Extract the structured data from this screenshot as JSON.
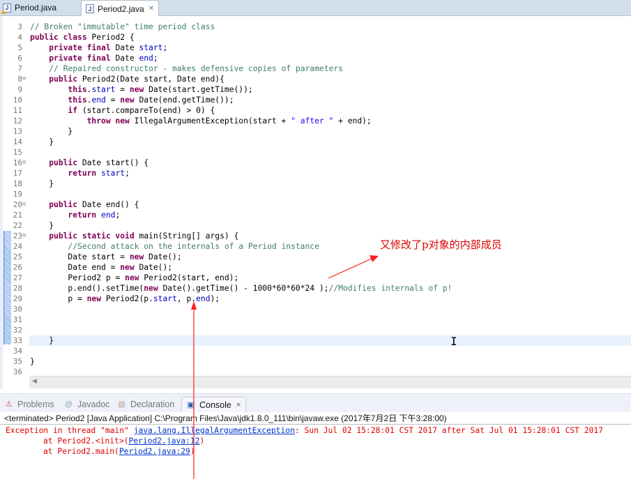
{
  "editor_tabs": [
    {
      "label": "Period.java",
      "icon": "java-file-warning-icon",
      "active": false
    },
    {
      "label": "Period2.java",
      "icon": "java-file-icon",
      "active": true,
      "close": "✕"
    }
  ],
  "code_lines": [
    {
      "n": "3",
      "fold": false,
      "html_parts": [
        {
          "c": "cm",
          "t": "// Broken \"immutable\" time period class"
        }
      ]
    },
    {
      "n": "4",
      "fold": false,
      "html_parts": [
        {
          "c": "kw",
          "t": "public class"
        },
        {
          "c": "",
          "t": " Period2 {"
        }
      ]
    },
    {
      "n": "5",
      "fold": false,
      "html_parts": [
        {
          "c": "",
          "t": "    "
        },
        {
          "c": "kw",
          "t": "private final"
        },
        {
          "c": "",
          "t": " Date "
        },
        {
          "c": "fd",
          "t": "start"
        },
        {
          "c": "",
          "t": ";"
        }
      ]
    },
    {
      "n": "6",
      "fold": false,
      "html_parts": [
        {
          "c": "",
          "t": "    "
        },
        {
          "c": "kw",
          "t": "private final"
        },
        {
          "c": "",
          "t": " Date "
        },
        {
          "c": "fd",
          "t": "end"
        },
        {
          "c": "",
          "t": ";"
        }
      ]
    },
    {
      "n": "7",
      "fold": false,
      "html_parts": [
        {
          "c": "",
          "t": "    "
        },
        {
          "c": "cm",
          "t": "// Repaired constructor - makes defensive copies of parameters"
        }
      ]
    },
    {
      "n": "8",
      "fold": true,
      "html_parts": [
        {
          "c": "",
          "t": "    "
        },
        {
          "c": "kw",
          "t": "public"
        },
        {
          "c": "",
          "t": " Period2(Date start, Date end){"
        }
      ]
    },
    {
      "n": "9",
      "fold": false,
      "html_parts": [
        {
          "c": "",
          "t": "        "
        },
        {
          "c": "kw",
          "t": "this"
        },
        {
          "c": "",
          "t": "."
        },
        {
          "c": "fd",
          "t": "start"
        },
        {
          "c": "",
          "t": " = "
        },
        {
          "c": "kw",
          "t": "new"
        },
        {
          "c": "",
          "t": " Date(start.getTime());"
        }
      ]
    },
    {
      "n": "10",
      "fold": false,
      "html_parts": [
        {
          "c": "",
          "t": "        "
        },
        {
          "c": "kw",
          "t": "this"
        },
        {
          "c": "",
          "t": "."
        },
        {
          "c": "fd",
          "t": "end"
        },
        {
          "c": "",
          "t": " = "
        },
        {
          "c": "kw",
          "t": "new"
        },
        {
          "c": "",
          "t": " Date(end.getTime());"
        }
      ]
    },
    {
      "n": "11",
      "fold": false,
      "html_parts": [
        {
          "c": "",
          "t": "        "
        },
        {
          "c": "kw",
          "t": "if"
        },
        {
          "c": "",
          "t": " (start.compareTo(end) > 0) {"
        }
      ]
    },
    {
      "n": "12",
      "fold": false,
      "html_parts": [
        {
          "c": "",
          "t": "            "
        },
        {
          "c": "kw",
          "t": "throw new"
        },
        {
          "c": "",
          "t": " IllegalArgumentException(start + "
        },
        {
          "c": "st",
          "t": "\" after \""
        },
        {
          "c": "",
          "t": " + end);"
        }
      ]
    },
    {
      "n": "13",
      "fold": false,
      "html_parts": [
        {
          "c": "",
          "t": "        }"
        }
      ]
    },
    {
      "n": "14",
      "fold": false,
      "html_parts": [
        {
          "c": "",
          "t": "    }"
        }
      ]
    },
    {
      "n": "15",
      "fold": false,
      "html_parts": []
    },
    {
      "n": "16",
      "fold": true,
      "html_parts": [
        {
          "c": "",
          "t": "    "
        },
        {
          "c": "kw",
          "t": "public"
        },
        {
          "c": "",
          "t": " Date start() {"
        }
      ]
    },
    {
      "n": "17",
      "fold": false,
      "html_parts": [
        {
          "c": "",
          "t": "        "
        },
        {
          "c": "kw",
          "t": "return"
        },
        {
          "c": "",
          "t": " "
        },
        {
          "c": "fd",
          "t": "start"
        },
        {
          "c": "",
          "t": ";"
        }
      ]
    },
    {
      "n": "18",
      "fold": false,
      "html_parts": [
        {
          "c": "",
          "t": "    }"
        }
      ]
    },
    {
      "n": "19",
      "fold": false,
      "html_parts": []
    },
    {
      "n": "20",
      "fold": true,
      "html_parts": [
        {
          "c": "",
          "t": "    "
        },
        {
          "c": "kw",
          "t": "public"
        },
        {
          "c": "",
          "t": " Date end() {"
        }
      ]
    },
    {
      "n": "21",
      "fold": false,
      "html_parts": [
        {
          "c": "",
          "t": "        "
        },
        {
          "c": "kw",
          "t": "return"
        },
        {
          "c": "",
          "t": " "
        },
        {
          "c": "fd",
          "t": "end"
        },
        {
          "c": "",
          "t": ";"
        }
      ]
    },
    {
      "n": "22",
      "fold": false,
      "html_parts": [
        {
          "c": "",
          "t": "    }"
        }
      ]
    },
    {
      "n": "23",
      "fold": true,
      "html_parts": [
        {
          "c": "",
          "t": "    "
        },
        {
          "c": "kw",
          "t": "public static void"
        },
        {
          "c": "",
          "t": " main(String[] args) {"
        }
      ]
    },
    {
      "n": "24",
      "fold": false,
      "html_parts": [
        {
          "c": "",
          "t": "        "
        },
        {
          "c": "cm",
          "t": "//Second attack on the internals of a Period instance"
        }
      ]
    },
    {
      "n": "25",
      "fold": false,
      "html_parts": [
        {
          "c": "",
          "t": "        Date start = "
        },
        {
          "c": "kw",
          "t": "new"
        },
        {
          "c": "",
          "t": " Date();"
        }
      ]
    },
    {
      "n": "26",
      "fold": false,
      "html_parts": [
        {
          "c": "",
          "t": "        Date end = "
        },
        {
          "c": "kw",
          "t": "new"
        },
        {
          "c": "",
          "t": " Date();"
        }
      ]
    },
    {
      "n": "27",
      "fold": false,
      "html_parts": [
        {
          "c": "",
          "t": "        Period2 p = "
        },
        {
          "c": "kw",
          "t": "new"
        },
        {
          "c": "",
          "t": " Period2(start, end);"
        }
      ]
    },
    {
      "n": "28",
      "fold": false,
      "html_parts": [
        {
          "c": "",
          "t": "        p.end().setTime("
        },
        {
          "c": "kw",
          "t": "new"
        },
        {
          "c": "",
          "t": " Date().getTime() - 1000*60*60*24 );"
        },
        {
          "c": "cm",
          "t": "//Modifies internals of p!"
        }
      ]
    },
    {
      "n": "29",
      "fold": false,
      "html_parts": [
        {
          "c": "",
          "t": "        p = "
        },
        {
          "c": "kw",
          "t": "new"
        },
        {
          "c": "",
          "t": " Period2(p."
        },
        {
          "c": "fd",
          "t": "start"
        },
        {
          "c": "",
          "t": ", p."
        },
        {
          "c": "fd",
          "t": "end"
        },
        {
          "c": "",
          "t": ");"
        }
      ]
    },
    {
      "n": "30",
      "fold": false,
      "html_parts": []
    },
    {
      "n": "31",
      "fold": false,
      "html_parts": []
    },
    {
      "n": "32",
      "fold": false,
      "html_parts": []
    },
    {
      "n": "33",
      "fold": false,
      "current": true,
      "html_parts": [
        {
          "c": "",
          "t": "    }"
        }
      ]
    },
    {
      "n": "34",
      "fold": false,
      "html_parts": []
    },
    {
      "n": "35",
      "fold": false,
      "html_parts": [
        {
          "c": "",
          "t": "}"
        }
      ]
    },
    {
      "n": "36",
      "fold": false,
      "html_parts": []
    }
  ],
  "annotation": {
    "text": "又修改了p对象的内部成员",
    "color": "#e00000"
  },
  "view_tabs": [
    {
      "label": "Problems",
      "icon": "problems-icon",
      "glyph": "⚠",
      "active": false
    },
    {
      "label": "Javadoc",
      "icon": "javadoc-icon",
      "glyph": "@",
      "active": false
    },
    {
      "label": "Declaration",
      "icon": "declaration-icon",
      "glyph": "▤",
      "active": false
    },
    {
      "label": "Console",
      "icon": "console-icon",
      "glyph": "▣",
      "active": true,
      "close": "✕"
    }
  ],
  "console": {
    "header": "<terminated> Period2 [Java Application] C:\\Program Files\\Java\\jdk1.8.0_111\\bin\\javaw.exe (2017年7月2日 下午3:28:00)",
    "exception_prefix": "Exception in thread \"main\" ",
    "exception_class": "java.lang.IllegalArgumentException",
    "exception_message": ": Sun Jul 02 15:28:01 CST 2017 after Sat Jul 01 15:28:01 CST 2017",
    "stack": [
      {
        "prefix": "\tat Period2.<init>(",
        "link": "Period2.java:12",
        "suffix": ")"
      },
      {
        "prefix": "\tat Period2.main(",
        "link": "Period2.java:29",
        "suffix": ")"
      }
    ]
  },
  "colors": {
    "keyword": "#7f0055",
    "comment": "#3f7f5f",
    "field": "#0000c0",
    "string": "#2a00ff",
    "error": "#e00000",
    "link": "#0033cc"
  }
}
